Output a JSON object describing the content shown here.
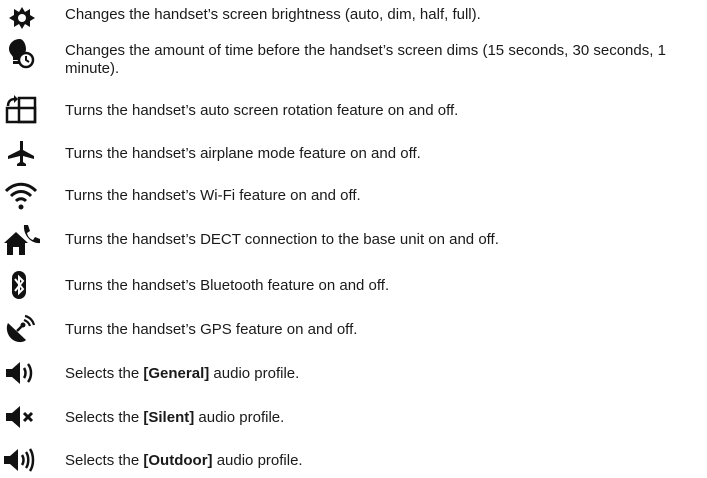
{
  "rows": [
    {
      "icon": "brightness-icon",
      "text": "Changes the handset’s screen brightness (auto, dim, half, full)."
    },
    {
      "icon": "screen-timeout-icon",
      "text": "Changes the amount of time before the handset’s screen dims (15 seconds, 30 seconds, 1 minute)."
    },
    {
      "icon": "auto-rotate-icon",
      "text": "Turns the handset’s auto screen rotation feature on and off."
    },
    {
      "icon": "airplane-icon",
      "text": "Turns the handset’s airplane mode feature on and off."
    },
    {
      "icon": "wifi-icon",
      "text": "Turns the handset’s Wi-Fi feature on and off."
    },
    {
      "icon": "dect-icon",
      "text": "Turns the handset’s DECT connection to the base unit on and off."
    },
    {
      "icon": "bluetooth-icon",
      "text": "Turns the handset’s Bluetooth feature on and off."
    },
    {
      "icon": "gps-icon",
      "text": "Turns the handset’s GPS feature on and off."
    },
    {
      "icon": "audio-general-icon",
      "text_pre": "Selects the ",
      "text_bold": "[General]",
      "text_post": " audio profile."
    },
    {
      "icon": "audio-silent-icon",
      "text_pre": "Selects the ",
      "text_bold": "[Silent]",
      "text_post": " audio profile."
    },
    {
      "icon": "audio-outdoor-icon",
      "text_pre": "Selects the ",
      "text_bold": "[Outdoor]",
      "text_post": " audio profile."
    }
  ]
}
